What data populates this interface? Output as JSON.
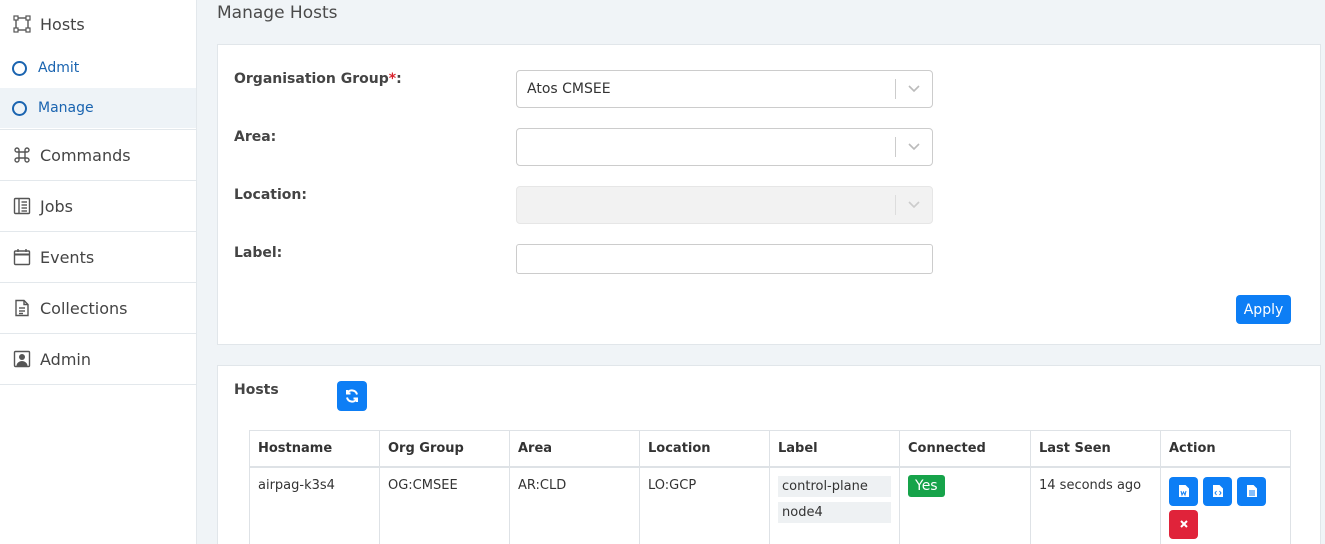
{
  "sidebar": {
    "hosts": {
      "label": "Hosts",
      "icon": "hosts-icon"
    },
    "sub_items": [
      {
        "label": "Admit"
      },
      {
        "label": "Manage",
        "active": true
      }
    ],
    "items": [
      {
        "label": "Commands",
        "icon": "command-icon"
      },
      {
        "label": "Jobs",
        "icon": "jobs-icon"
      },
      {
        "label": "Events",
        "icon": "calendar-icon"
      },
      {
        "label": "Collections",
        "icon": "document-icon"
      },
      {
        "label": "Admin",
        "icon": "user-icon"
      }
    ]
  },
  "page": {
    "title": "Manage Hosts"
  },
  "filter": {
    "org_group": {
      "label": "Organisation Group",
      "required_mark": "*",
      "suffix": ":",
      "value": "Atos CMSEE"
    },
    "area": {
      "label": "Area:",
      "value": ""
    },
    "location": {
      "label": "Location:",
      "value": ""
    },
    "label": {
      "label": "Label:",
      "value": ""
    },
    "apply_label": "Apply"
  },
  "hosts": {
    "title": "Hosts",
    "columns": [
      "Hostname",
      "Org Group",
      "Area",
      "Location",
      "Label",
      "Connected",
      "Last Seen",
      "Action"
    ],
    "rows": [
      {
        "hostname": "airpag-k3s4",
        "org_group": "OG:CMSEE",
        "area": "AR:CLD",
        "location": "LO:GCP",
        "labels": [
          "control-plane",
          "node4"
        ],
        "connected": "Yes",
        "last_seen": "14 seconds ago"
      }
    ]
  },
  "colors": {
    "primary": "#0d7ef5",
    "success": "#16a34a",
    "danger": "#e0233a",
    "link": "#1a64b0"
  }
}
